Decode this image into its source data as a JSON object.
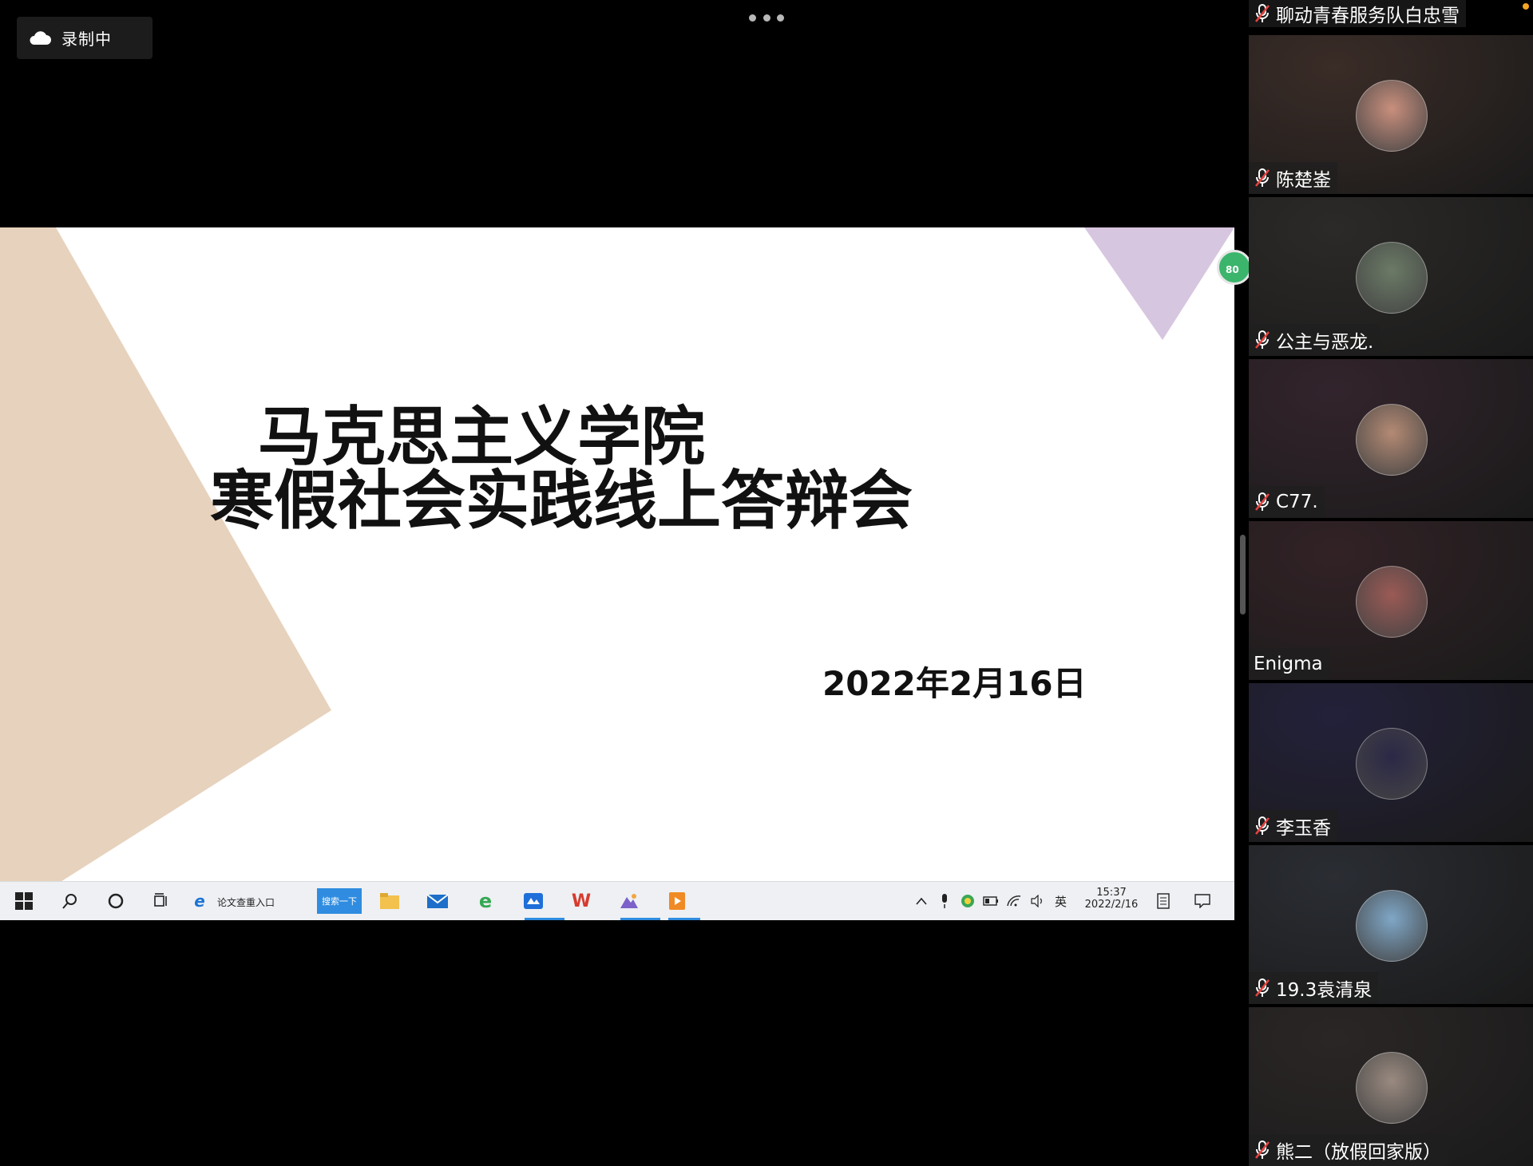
{
  "recording": {
    "label": "录制中",
    "icon": "cloud-icon"
  },
  "slide": {
    "title_line1": "马克思主义学院",
    "title_line2": "寒假社会实践线上答辩会",
    "date": "2022年2月16日",
    "float_badge": "80",
    "colors": {
      "beige": "#e7d2bd",
      "lavender": "#d7c6e0"
    }
  },
  "taskbar": {
    "pinned_label": "论文查重入口",
    "search_button": "搜索一下",
    "ime": "英",
    "time": "15:37",
    "date": "2022/2/16"
  },
  "participants": {
    "top_partial": "聊动青春服务队白忠雪",
    "tiles": [
      {
        "name": "陈楚崟",
        "muted": true,
        "bg": "#3a2c27",
        "avatar": "#c98f7d"
      },
      {
        "name": "公主与恶龙.",
        "muted": true,
        "bg": "#2c2a28",
        "avatar": "#6b7a66"
      },
      {
        "name": "C77.",
        "muted": true,
        "bg": "#33242c",
        "avatar": "#b48a74"
      },
      {
        "name": "Enigma",
        "muted": false,
        "bg": "#322226",
        "avatar": "#9b5a55"
      },
      {
        "name": "李玉香",
        "muted": true,
        "bg": "#23213a",
        "avatar": "#2b2846"
      },
      {
        "name": "19.3袁清泉",
        "muted": true,
        "bg": "#2a2d33",
        "avatar": "#7fa7c7"
      },
      {
        "name": "熊二（放假回家版）",
        "muted": true,
        "bg": "#2b2626",
        "avatar": "#9a8a80"
      }
    ]
  }
}
